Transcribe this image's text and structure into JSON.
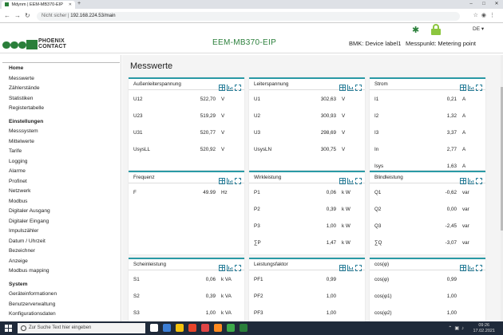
{
  "browser": {
    "tab_title": "Mdynm | EEM-MB370-EIP",
    "url_prefix": "Nicht sicher",
    "url": "192.168.224.53/main"
  },
  "topbar": {
    "language": "DE"
  },
  "header": {
    "logo_text_1": "PHOENIX",
    "logo_text_2": "CONTACT",
    "device_name": "EEM-MB370-EIP",
    "bmk": "BMK: Device label1",
    "messpunkt": "Messpunkt: Metering point"
  },
  "sidebar": {
    "groups": [
      {
        "title": "Home",
        "items": [
          "Messwerte",
          "Zählerstände",
          "Statistiken",
          "Registertabelle"
        ]
      },
      {
        "title": "Einstellungen",
        "items": [
          "Messsystem",
          "Mittelwerte",
          "Tarife",
          "Logging",
          "Alarme",
          "Profinet",
          "Netzwerk",
          "Modbus",
          "Digitaler Ausgang",
          "Digitaler Eingang",
          "Impulszähler",
          "Datum / Uhrzeit",
          "Bezeichner",
          "Anzeige",
          "Modbus mapping"
        ]
      },
      {
        "title": "System",
        "items": [
          "Geräteinformationen",
          "Benutzerverwaltung",
          "Konfigurationsdaten"
        ]
      }
    ]
  },
  "main": {
    "title": "Messwerte",
    "cards": [
      {
        "title": "Außenleiterspannung",
        "rows": [
          [
            "U12",
            "522,70",
            "V"
          ],
          [
            "U23",
            "519,29",
            "V"
          ],
          [
            "U31",
            "520,77",
            "V"
          ],
          [
            "UsysLL",
            "520,92",
            "V"
          ]
        ]
      },
      {
        "title": "Leiterspannung",
        "rows": [
          [
            "U1",
            "302,63",
            "V"
          ],
          [
            "U2",
            "300,93",
            "V"
          ],
          [
            "U3",
            "298,69",
            "V"
          ],
          [
            "UsysLN",
            "300,75",
            "V"
          ]
        ]
      },
      {
        "title": "Strom",
        "rows": [
          [
            "I1",
            "0,21",
            "A"
          ],
          [
            "I2",
            "1,32",
            "A"
          ],
          [
            "I3",
            "3,37",
            "A"
          ],
          [
            "In",
            "2,77",
            "A"
          ],
          [
            "Isys",
            "1,63",
            "A"
          ]
        ]
      },
      {
        "title": "Frequenz",
        "rows": [
          [
            "F",
            "49.99",
            "Hz"
          ]
        ]
      },
      {
        "title": "Wirkleistung",
        "rows": [
          [
            "P1",
            "0,06",
            "k W"
          ],
          [
            "P2",
            "0,39",
            "k W"
          ],
          [
            "P3",
            "1,00",
            "k W"
          ],
          [
            "∑P",
            "1,47",
            "k W"
          ]
        ]
      },
      {
        "title": "Blindleistung",
        "rows": [
          [
            "Q1",
            "-0,62",
            "var"
          ],
          [
            "Q2",
            "0,00",
            "var"
          ],
          [
            "Q3",
            "-2,45",
            "var"
          ],
          [
            "∑Q",
            "-3,07",
            "var"
          ]
        ]
      },
      {
        "title": "Scheinleistung",
        "rows": [
          [
            "S1",
            "0,06",
            "k VA"
          ],
          [
            "S2",
            "0,39",
            "k VA"
          ],
          [
            "S3",
            "1,00",
            "k VA"
          ]
        ]
      },
      {
        "title": "Leistungsfaktor",
        "rows": [
          [
            "PF1",
            "0,99",
            ""
          ],
          [
            "PF2",
            "1,00",
            ""
          ],
          [
            "PF3",
            "1,00",
            ""
          ]
        ]
      },
      {
        "title": "cos(φ)",
        "rows": [
          [
            "cos(φ)",
            "0,99",
            ""
          ],
          [
            "cos(φ1)",
            "1,00",
            ""
          ],
          [
            "cos(φ2)",
            "1,00",
            ""
          ],
          [
            "cos(φ3)",
            "1,00",
            ""
          ]
        ]
      }
    ]
  },
  "taskbar": {
    "search_placeholder": "Zur Suche Text hier eingeben",
    "time": "09:26",
    "date": "17.02.2021"
  },
  "colors": {
    "accent": "#2a7f3a",
    "card_border": "#2a9aa6",
    "lock": "#8cc63f"
  }
}
